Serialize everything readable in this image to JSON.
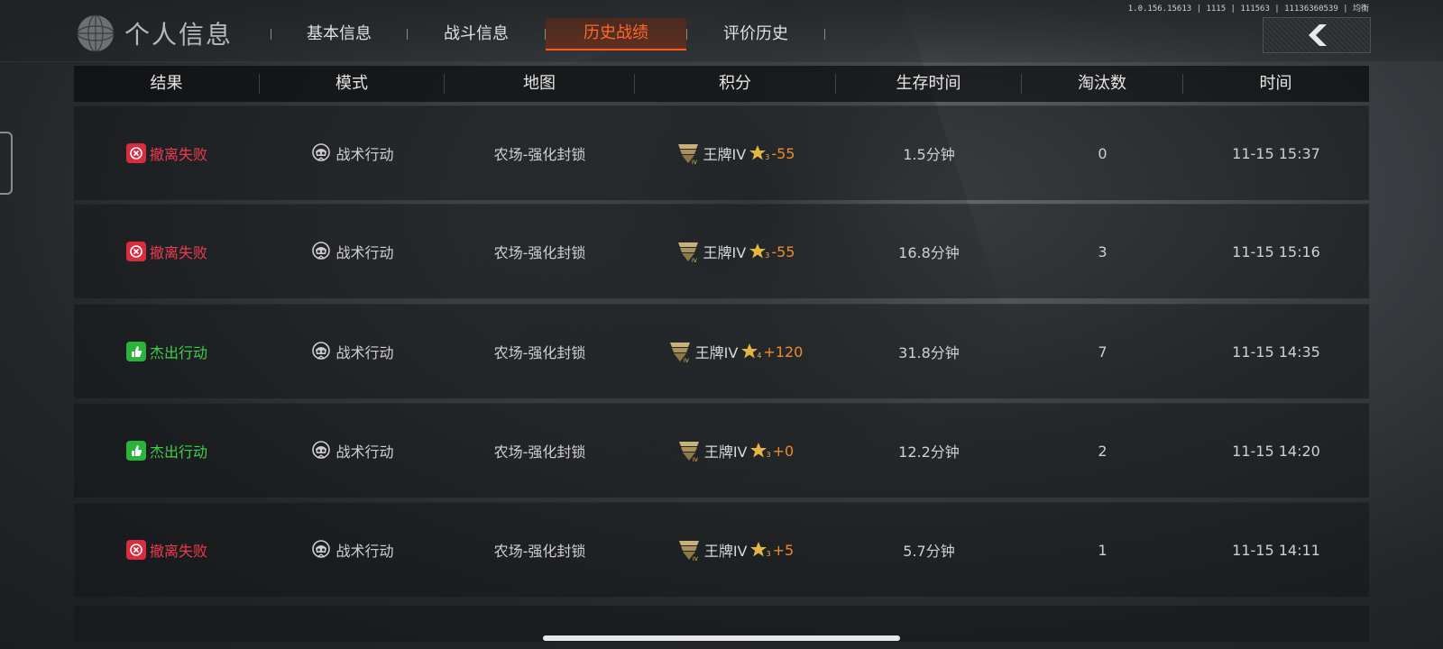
{
  "header": {
    "title": "个人信息",
    "version": "1.0.156.15613 | 1115 | 111563 | 11136360539 | 均衡",
    "tabs": [
      {
        "label": "基本信息",
        "active": false
      },
      {
        "label": "战斗信息",
        "active": false
      },
      {
        "label": "历史战绩",
        "active": true
      },
      {
        "label": "评价历史",
        "active": false
      }
    ],
    "back_icon": "chevron-left-icon"
  },
  "table": {
    "columns": [
      "结果",
      "模式",
      "地图",
      "积分",
      "生存时间",
      "淘汰数",
      "时间"
    ],
    "rows": [
      {
        "result": "撤离失败",
        "status": "fail",
        "mode": "战术行动",
        "map": "农场-强化封锁",
        "rank": "王牌IV",
        "stars": "3",
        "delta": "-55",
        "survival": "1.5分钟",
        "kills": "0",
        "time": "11-15 15:37"
      },
      {
        "result": "撤离失败",
        "status": "fail",
        "mode": "战术行动",
        "map": "农场-强化封锁",
        "rank": "王牌IV",
        "stars": "3",
        "delta": "-55",
        "survival": "16.8分钟",
        "kills": "3",
        "time": "11-15 15:16"
      },
      {
        "result": "杰出行动",
        "status": "success",
        "mode": "战术行动",
        "map": "农场-强化封锁",
        "rank": "王牌IV",
        "stars": "4",
        "delta": "+120",
        "survival": "31.8分钟",
        "kills": "7",
        "time": "11-15 14:35"
      },
      {
        "result": "杰出行动",
        "status": "success",
        "mode": "战术行动",
        "map": "农场-强化封锁",
        "rank": "王牌IV",
        "stars": "3",
        "delta": "+0",
        "survival": "12.2分钟",
        "kills": "2",
        "time": "11-15 14:20"
      },
      {
        "result": "撤离失败",
        "status": "fail",
        "mode": "战术行动",
        "map": "农场-强化封锁",
        "rank": "王牌IV",
        "stars": "3",
        "delta": "+5",
        "survival": "5.7分钟",
        "kills": "1",
        "time": "11-15 14:11"
      }
    ]
  },
  "colors": {
    "accent": "#ff5a1a",
    "fail": "#ee3b4f",
    "success": "#3fd04a",
    "score_delta": "#f08a28"
  }
}
